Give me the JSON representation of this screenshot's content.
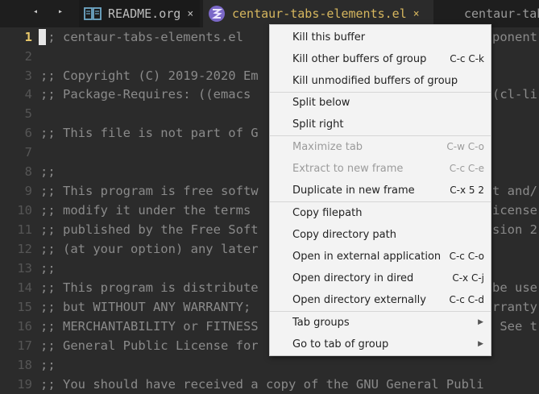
{
  "tabs": {
    "nav_prev": "◂",
    "nav_next": "▸",
    "readme_label": "README.org",
    "active_label": "centaur-tabs-elements.el",
    "third_label": "centaur-tab",
    "close_glyph": "×"
  },
  "editor": {
    "lines": [
      {
        "n": "1",
        "text": ";; centaur-tabs-elements.el"
      },
      {
        "n": "2",
        "text": ""
      },
      {
        "n": "3",
        "text": ";; Copyright (C) 2019-2020 Em"
      },
      {
        "n": "4",
        "text": ";; Package-Requires: ((emacs"
      },
      {
        "n": "5",
        "text": ""
      },
      {
        "n": "6",
        "text": ";; This file is not part of G"
      },
      {
        "n": "7",
        "text": ""
      },
      {
        "n": "8",
        "text": ";;"
      },
      {
        "n": "9",
        "text": ";; This program is free softw"
      },
      {
        "n": "10",
        "text": ";; modify it under the terms"
      },
      {
        "n": "11",
        "text": ";; published by the Free Soft"
      },
      {
        "n": "12",
        "text": ";; (at your option) any later"
      },
      {
        "n": "13",
        "text": ";;"
      },
      {
        "n": "14",
        "text": ";; This program is distribute"
      },
      {
        "n": "15",
        "text": ";; but WITHOUT ANY WARRANTY;"
      },
      {
        "n": "16",
        "text": ";; MERCHANTABILITY or FITNESS"
      },
      {
        "n": "17",
        "text": ";; General Public License for"
      },
      {
        "n": "18",
        "text": ";;"
      },
      {
        "n": "19",
        "text": ";; You should have received a copy of the GNU General Publi"
      }
    ],
    "right_fragments": [
      {
        "line": 1,
        "text": "ponent"
      },
      {
        "line": 4,
        "text": "(cl-li"
      },
      {
        "line": 9,
        "text": "t and/"
      },
      {
        "line": 10,
        "text": "icense"
      },
      {
        "line": 11,
        "text": "sion 2"
      },
      {
        "line": 14,
        "text": "be use"
      },
      {
        "line": 15,
        "text": "rranty"
      },
      {
        "line": 16,
        "text": " See t"
      }
    ]
  },
  "context_menu": {
    "items": [
      {
        "label": "Kill this buffer",
        "shortcut": "",
        "disabled": false
      },
      {
        "label": "Kill other buffers of group",
        "shortcut": "C-c C-k",
        "disabled": false
      },
      {
        "label": "Kill unmodified buffers of group",
        "shortcut": "",
        "disabled": false
      },
      {
        "label": "Split below",
        "shortcut": "",
        "disabled": false
      },
      {
        "label": "Split right",
        "shortcut": "",
        "disabled": false
      },
      {
        "label": "Maximize tab",
        "shortcut": "C-w C-o",
        "disabled": true
      },
      {
        "label": "Extract to new frame",
        "shortcut": "C-c C-e",
        "disabled": true
      },
      {
        "label": "Duplicate in new frame",
        "shortcut": "C-x 5 2",
        "disabled": false
      },
      {
        "label": "Copy filepath",
        "shortcut": "",
        "disabled": false
      },
      {
        "label": "Copy directory path",
        "shortcut": "",
        "disabled": false
      },
      {
        "label": "Open in external application",
        "shortcut": "C-c C-o",
        "disabled": false
      },
      {
        "label": "Open directory in dired",
        "shortcut": "C-x C-j",
        "disabled": false
      },
      {
        "label": "Open directory externally",
        "shortcut": "C-c C-d",
        "disabled": false
      },
      {
        "label": "Tab groups",
        "shortcut": "",
        "disabled": false,
        "submenu": true
      },
      {
        "label": "Go to tab of group",
        "shortcut": "",
        "disabled": false,
        "submenu": true
      }
    ],
    "submenu_arrow": "▶"
  },
  "colors": {
    "editor_bg": "#2b2b2b",
    "active_tab_fg": "#d6b65e",
    "emacs_icon": "#7b68c8",
    "readme_icon": "#6fa8c8"
  }
}
